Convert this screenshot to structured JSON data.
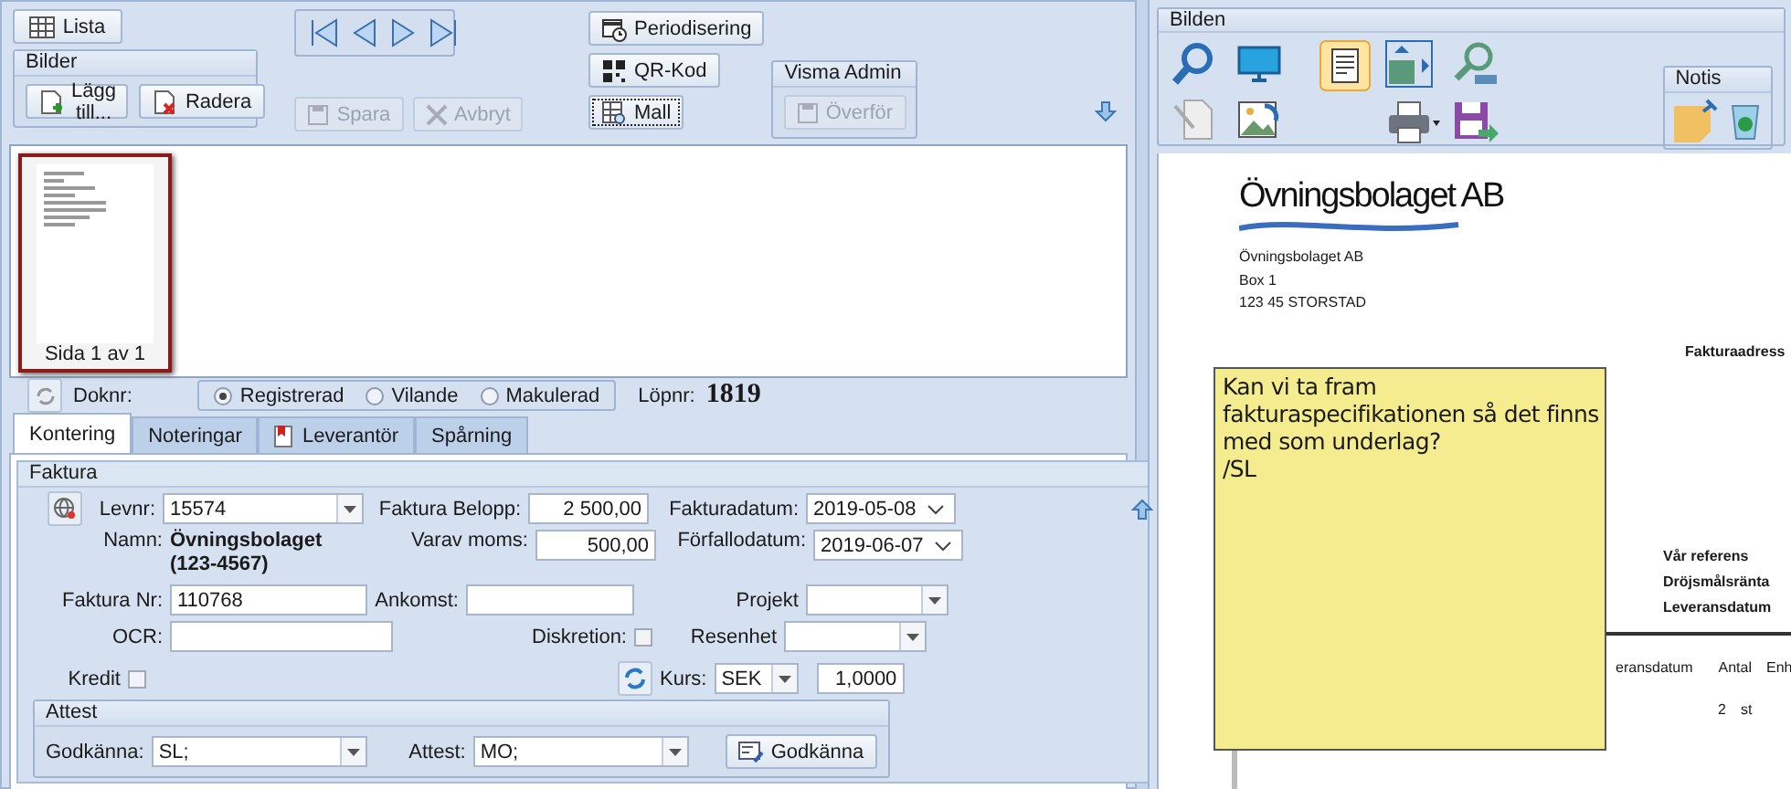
{
  "toolbar": {
    "lista": {
      "label": "Lista"
    },
    "bilder": {
      "title": "Bilder",
      "buttons": [
        {
          "kind": "add",
          "label": "Lägg till...",
          "disabled": false
        },
        {
          "kind": "delete",
          "label": "Radera",
          "disabled": false
        }
      ]
    },
    "edit_buttons": [
      {
        "kind": "save",
        "label": "Spara",
        "disabled": true
      },
      {
        "kind": "cancel",
        "label": "Avbryt",
        "disabled": true
      }
    ],
    "tool_buttons": [
      {
        "kind": "calendar",
        "label": "Periodisering",
        "focused": false
      },
      {
        "kind": "qr",
        "label": "QR-Kod",
        "focused": false
      },
      {
        "kind": "template",
        "label": "Mall",
        "focused": true
      }
    ],
    "visma_admin": {
      "title": "Visma Admin",
      "button": {
        "label": "Överför",
        "disabled": true
      }
    }
  },
  "thumbnails": [
    {
      "caption": "Sida 1 av 1",
      "selected": true
    }
  ],
  "status": {
    "doknr_label": "Doknr:",
    "options": [
      {
        "label": "Registrerad",
        "selected": true
      },
      {
        "label": "Vilande",
        "selected": false
      },
      {
        "label": "Makulerad",
        "selected": false
      }
    ],
    "lopnr_label": "Löpnr:",
    "lopnr": "1819"
  },
  "tabs": [
    {
      "label": "Kontering",
      "selected": true,
      "kind": "plain"
    },
    {
      "label": "Noteringar",
      "selected": false,
      "kind": "plain"
    },
    {
      "label": "Leverantör",
      "selected": false,
      "kind": "icon"
    },
    {
      "label": "Spårning",
      "selected": false,
      "kind": "plain"
    }
  ],
  "faktura": {
    "title": "Faktura",
    "levnr": {
      "label": "Levnr:",
      "value": "15574"
    },
    "faktura_belopp": {
      "label": "Faktura Belopp:",
      "value": "2 500,00"
    },
    "fakturadatum": {
      "label": "Fakturadatum:",
      "value": "2019-05-08"
    },
    "namn": {
      "label": "Namn:",
      "lines": [
        "Övningsbolaget",
        "(123-4567)"
      ]
    },
    "varav_moms": {
      "label": "Varav moms:",
      "value": "500,00"
    },
    "forfallodatum": {
      "label": "Förfallodatum:",
      "value": "2019-06-07"
    },
    "faktura_nr": {
      "label": "Faktura Nr:",
      "value": "110768"
    },
    "ankomst": {
      "label": "Ankomst:"
    },
    "projekt": {
      "label": "Projekt"
    },
    "ocr": {
      "label": "OCR:"
    },
    "diskretion": {
      "label": "Diskretion:",
      "checked": false
    },
    "resenhet": {
      "label": "Resenhet"
    },
    "kredit": {
      "label": "Kredit",
      "checked": false
    },
    "kurs": {
      "label": "Kurs:",
      "currency": "SEK",
      "rate": "1,0000"
    },
    "attest": {
      "title": "Attest",
      "godkanna": {
        "label": "Godkänna:",
        "value": "SL;"
      },
      "attest": {
        "label": "Attest:",
        "value": "MO;"
      },
      "button": "Godkänna"
    }
  },
  "image_panel": {
    "group_title": "Bilden",
    "notis_title": "Notis",
    "preview": {
      "logo": "Övningsbolaget AB",
      "address_lines": [
        "Övningsbolaget AB",
        "Box 1",
        "123 45  STORSTAD"
      ],
      "invoice_address_label": "Fakturaadress",
      "references": [
        "Vår referens",
        "Dröjsmålsränta",
        "Leveransdatum"
      ],
      "table_headers": [
        "eransdatum",
        "Antal",
        "Enh"
      ],
      "rows": [
        {
          "antal": "2",
          "enh": "st"
        }
      ]
    },
    "note": {
      "lines": [
        "Kan vi ta fram",
        "fakturaspecifikationen så det finns",
        "med som underlag?",
        "/SL"
      ]
    }
  }
}
